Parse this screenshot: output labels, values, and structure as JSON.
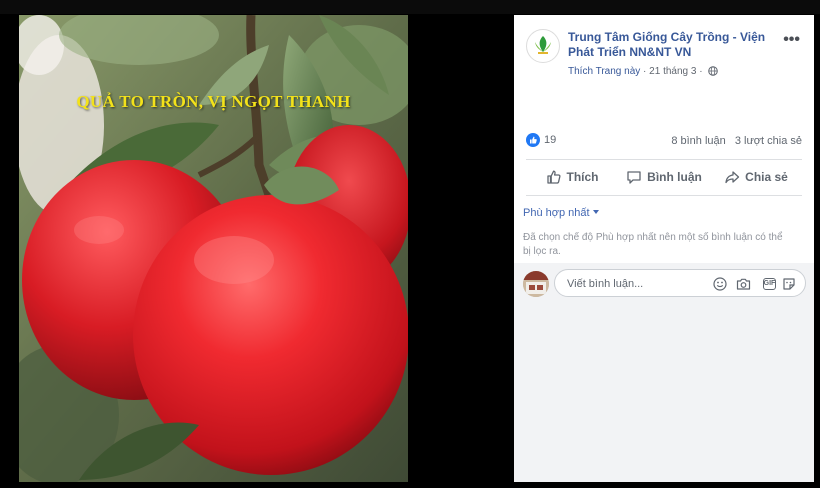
{
  "photo": {
    "caption": "QUẢ TO TRÒN, VỊ NGỌT THANH"
  },
  "post": {
    "page_name": "Trung Tâm Giống Cây Trồng - Viện Phát Triển NN&NT VN",
    "follow_label": "Thích Trang này",
    "separator": "·",
    "date": "21 tháng 3",
    "date_separator": "·",
    "more_label": "•••"
  },
  "stats": {
    "likes": "19",
    "comments": "8 bình luận",
    "shares": "3 lượt chia sẻ"
  },
  "actions": {
    "like": "Thích",
    "comment": "Bình luận",
    "share": "Chia sẻ"
  },
  "comments": {
    "sort_label": "Phù hợp nhất",
    "notice": "Đã chọn chế độ Phù hợp nhất nên một số bình luận có thể bị lọc ra.",
    "input_placeholder": "Viết bình luận...",
    "gif_label": "GIF"
  },
  "colors": {
    "link_blue": "#385898",
    "like_blue": "#2078f4",
    "caption_yellow": "#f3e21a",
    "fruit_red": "#e0222a"
  },
  "icons": [
    "like-reaction-icon",
    "thumbs-up-icon",
    "comment-icon",
    "share-icon",
    "globe-icon",
    "emoji-icon",
    "camera-icon",
    "gif-icon",
    "sticker-icon"
  ]
}
